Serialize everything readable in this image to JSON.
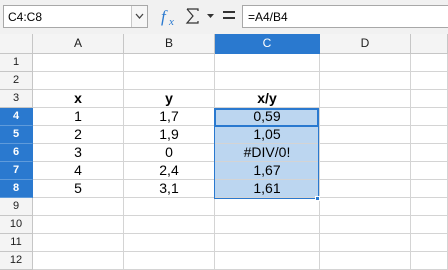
{
  "formula_bar": {
    "name_box": "C4:C8",
    "formula": "=A4/B4",
    "icons": {
      "function_wizard": "function-wizard-icon",
      "sum": "sum-icon",
      "sum_dropdown": "chevron-down-icon",
      "formula": "equals-icon"
    }
  },
  "columns": [
    "A",
    "B",
    "C",
    "D"
  ],
  "active_column": "C",
  "rows": [
    "1",
    "2",
    "3",
    "4",
    "5",
    "6",
    "7",
    "8",
    "9",
    "10",
    "11",
    "12"
  ],
  "active_rows": [
    "4",
    "5",
    "6",
    "7",
    "8"
  ],
  "cells": {
    "A3": "x",
    "B3": "y",
    "C3": "x/y",
    "A4": "1",
    "B4": "1,7",
    "C4": "0,59",
    "A5": "2",
    "B5": "1,9",
    "C5": "1,05",
    "A6": "3",
    "B6": "0",
    "C6": "#DIV/0!",
    "A7": "4",
    "B7": "2,4",
    "C7": "1,67",
    "A8": "5",
    "B8": "3,1",
    "C8": "1,61"
  },
  "colors": {
    "selection_accent": "#2a79cf",
    "selection_fill": "#bcd6f0",
    "header_background": "#f4f4f4"
  }
}
